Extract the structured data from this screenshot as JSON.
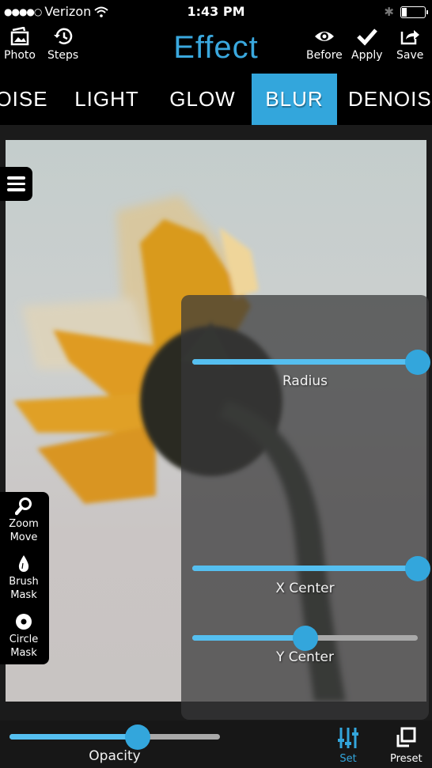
{
  "status_bar": {
    "signal": "●●●●○",
    "carrier": "Verizon",
    "time": "1:43 PM",
    "battery_level": 0.2
  },
  "header": {
    "title": "Effect",
    "left_buttons": [
      {
        "label": "Photo",
        "icon": "photo-icon"
      },
      {
        "label": "Steps",
        "icon": "history-icon"
      }
    ],
    "right_buttons": [
      {
        "label": "Before",
        "icon": "eye-icon"
      },
      {
        "label": "Apply",
        "icon": "checkmark-icon"
      },
      {
        "label": "Save",
        "icon": "share-icon"
      }
    ]
  },
  "tabs": [
    {
      "label": "NOISE",
      "visible_text": "OISE",
      "active": false
    },
    {
      "label": "LIGHT",
      "active": false
    },
    {
      "label": "GLOW",
      "active": false
    },
    {
      "label": "BLUR",
      "active": true
    },
    {
      "label": "DENOISE",
      "visible_text": "DENOIS",
      "active": false
    }
  ],
  "tools": [
    {
      "label_line1": "Zoom",
      "label_line2": "Move",
      "icon": "magnifier-icon"
    },
    {
      "label_line1": "Brush",
      "label_line2": "Mask",
      "icon": "droplet-icon"
    },
    {
      "label_line1": "Circle",
      "label_line2": "Mask",
      "icon": "circle-mask-icon"
    }
  ],
  "effect_sliders": [
    {
      "label": "Radius",
      "value": 1.0
    },
    {
      "label": "X Center",
      "value": 1.0
    },
    {
      "label": "Y Center",
      "value": 0.5
    }
  ],
  "bottom_bar": {
    "opacity": {
      "label": "Opacity",
      "value": 0.61
    },
    "buttons": [
      {
        "label": "Set",
        "icon": "sliders-icon",
        "active": true
      },
      {
        "label": "Preset",
        "icon": "preset-icon",
        "active": false
      }
    ]
  },
  "colors": {
    "accent": "#33a6dc",
    "slider_fill": "#55bff0",
    "slider_track": "#a9a9a9",
    "title": "#3aa8de"
  }
}
